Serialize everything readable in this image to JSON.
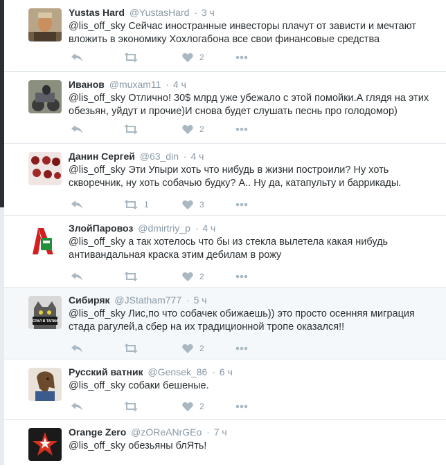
{
  "tweets": [
    {
      "fullname": "Yustas Hard",
      "username": "@YustasHard",
      "time": "3 ч",
      "mention": "@lis_off_sky",
      "text": "Сейчас иностранные инвесторы плачут от зависти и мечтают вложить в экономику Хохлогабона все свои финансовые средства",
      "retweets": "",
      "likes": "2"
    },
    {
      "fullname": "Иванов",
      "username": "@muxam11",
      "time": "4 ч",
      "mention": "@lis_off_sky",
      "text": "Отлично! 30$ млрд уже убежало с этой помойки.А глядя на этих обезьян, уйдут и прочие)И снова будет слушать песнь про голодомор)",
      "retweets": "",
      "likes": "2"
    },
    {
      "fullname": "Данин Сергей",
      "username": "@63_din",
      "time": "4 ч",
      "mention": "@lis_off_sky",
      "text": "Эти Упыри хоть что нибудь в жизни построили? Ну хоть скворечник, ну хоть собачью будку? А.. Ну да, катапульту и баррикады.",
      "retweets": "1",
      "likes": "3"
    },
    {
      "fullname": "ЗлойПаровоз",
      "username": "@dmirtriy_p",
      "time": "4 ч",
      "mention": "@lis_off_sky",
      "text": "а так хотелось что бы из стекла вылетела какая нибудь антивандальная краска этим дебилам в рожу",
      "retweets": "",
      "likes": "2"
    },
    {
      "fullname": "Сибиряк",
      "username": "@JStatham777",
      "time": "5 ч",
      "mention": "@lis_off_sky",
      "text": "Лис,по что собачек обижаешь)) это просто осенняя миграция стада рагулей,а сбер на их традиционной тропе оказался!!",
      "retweets": "",
      "likes": "2"
    },
    {
      "fullname": "Русский ватник",
      "username": "@Gensek_86",
      "time": "6 ч",
      "mention": "@lis_off_sky",
      "text": "собаки бешеные.",
      "retweets": "",
      "likes": "2"
    },
    {
      "fullname": "Orange Zero",
      "username": "@zOReANrGEo",
      "time": "7 ч",
      "mention": "@lis_off_sky",
      "text": "обезьяны блЯть!",
      "retweets": "",
      "likes": ""
    }
  ],
  "avatar_logo_text": "СРАЛ В ТАПКИ",
  "colors": {
    "name": "#292f33",
    "meta": "#8899a6",
    "icon": "#aab8c2",
    "highlight_bg": "#f5f8fa",
    "border": "#e1e8ed"
  },
  "icons": [
    "reply-icon",
    "retweet-icon",
    "heart-icon",
    "more-icon"
  ]
}
